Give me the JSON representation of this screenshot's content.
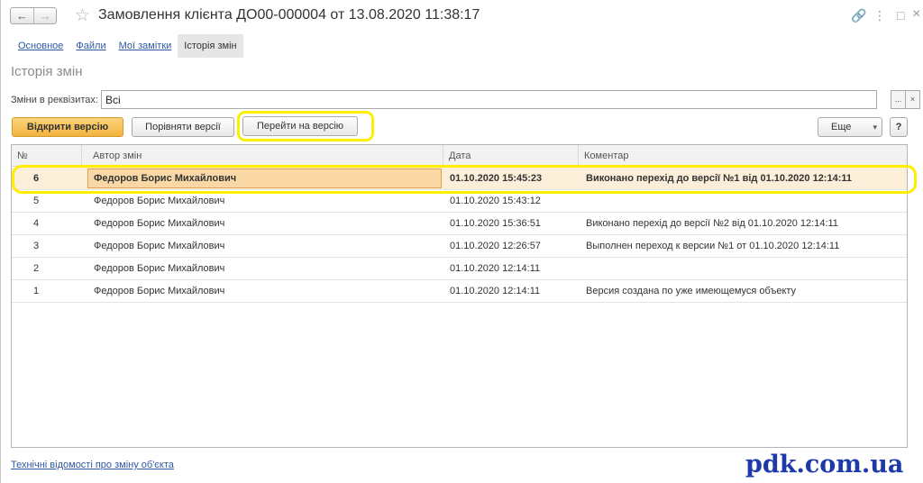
{
  "window": {
    "title": "Замовлення клієнта ДО00-000004 от 13.08.2020 11:38:17",
    "back_icon": "←",
    "forward_icon": "→",
    "star_icon": "☆",
    "link_icon": "🔗",
    "menu_icon": "⋮",
    "maximize_icon": "□",
    "close_icon": "×"
  },
  "tabs": [
    {
      "label": "Основное",
      "active": false
    },
    {
      "label": "Файли",
      "active": false
    },
    {
      "label": "Мої замітки",
      "active": false
    },
    {
      "label": "Історія змін",
      "active": true
    }
  ],
  "section_title": "Історія змін",
  "filter": {
    "label": "Зміни в реквізитах:",
    "value": "Всі",
    "select_btn": "...",
    "clear_btn": "×"
  },
  "toolbar": {
    "open_version": "Відкрити версію",
    "compare_versions": "Порівняти версії",
    "goto_version": "Перейти на версію",
    "more": "Еще",
    "more_arrow": "▾",
    "help": "?"
  },
  "table": {
    "columns": [
      "№",
      "Автор змін",
      "Дата",
      "Коментар"
    ],
    "rows": [
      {
        "num": "6",
        "author": "Федоров Борис Михайлович",
        "date": "01.10.2020 15:45:23",
        "comment": "Виконано перехід до версії №1 від 01.10.2020 12:14:11",
        "selected": true
      },
      {
        "num": "5",
        "author": "Федоров Борис Михайлович",
        "date": "01.10.2020 15:43:12",
        "comment": "",
        "selected": false
      },
      {
        "num": "4",
        "author": "Федоров Борис Михайлович",
        "date": "01.10.2020 15:36:51",
        "comment": "Виконано перехід до версії №2 від 01.10.2020 12:14:11",
        "selected": false
      },
      {
        "num": "3",
        "author": "Федоров Борис Михайлович",
        "date": "01.10.2020 12:26:57",
        "comment": "Выполнен переход к версии №1 от 01.10.2020 12:14:11",
        "selected": false
      },
      {
        "num": "2",
        "author": "Федоров Борис Михайлович",
        "date": "01.10.2020 12:14:11",
        "comment": "",
        "selected": false
      },
      {
        "num": "1",
        "author": "Федоров Борис Михайлович",
        "date": "01.10.2020 12:14:11",
        "comment": "Версия создана по уже имеющемуся объекту",
        "selected": false
      }
    ]
  },
  "footer_link": "Технічні відомості про зміну об'єкта",
  "watermark": "pdk.com.ua",
  "colors": {
    "accent": "#f3b23e",
    "link": "#2e58a6",
    "highlight": "#ffee00",
    "selected_row": "#fcefd9",
    "watermark": "#1e3aa8"
  }
}
